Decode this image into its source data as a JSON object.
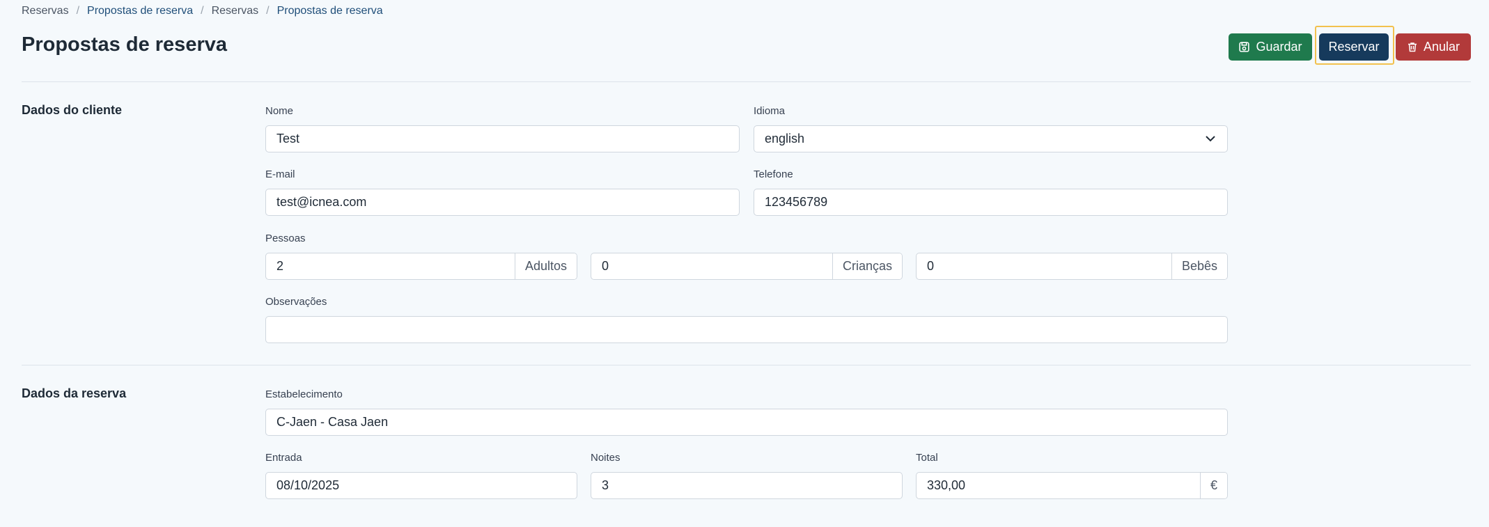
{
  "breadcrumb": [
    "Reservas",
    "Propostas de reserva",
    "Reservas",
    "Propostas de reserva"
  ],
  "page_title": "Propostas de reserva",
  "actions": {
    "save": "Guardar",
    "book": "Reservar",
    "cancel": "Anular"
  },
  "client": {
    "section_title": "Dados do cliente",
    "name": {
      "label": "Nome",
      "value": "Test"
    },
    "language": {
      "label": "Idioma",
      "value": "english"
    },
    "email": {
      "label": "E-mail",
      "value": "test@icnea.com"
    },
    "phone": {
      "label": "Telefone",
      "value": "123456789"
    },
    "people": {
      "label": "Pessoas",
      "adults": {
        "value": "2",
        "addon": "Adultos"
      },
      "children": {
        "value": "0",
        "addon": "Crianças"
      },
      "babies": {
        "value": "0",
        "addon": "Bebês"
      }
    },
    "notes": {
      "label": "Observações",
      "value": ""
    }
  },
  "booking": {
    "section_title": "Dados da reserva",
    "property": {
      "label": "Estabelecimento",
      "value": "C-Jaen - Casa Jaen"
    },
    "checkin": {
      "label": "Entrada",
      "value": "08/10/2025"
    },
    "nights": {
      "label": "Noites",
      "value": "3"
    },
    "total": {
      "label": "Total",
      "value": "330,00",
      "currency": "€"
    }
  },
  "icons": {
    "save": "save-icon",
    "cancel": "trash-icon",
    "language_select": "chevron-down-icon"
  },
  "colors": {
    "save": "#1f7a4d",
    "book": "#163a5c",
    "cancel": "#b23a3a",
    "focus": "#f2c14e",
    "link": "#1f4e79"
  }
}
